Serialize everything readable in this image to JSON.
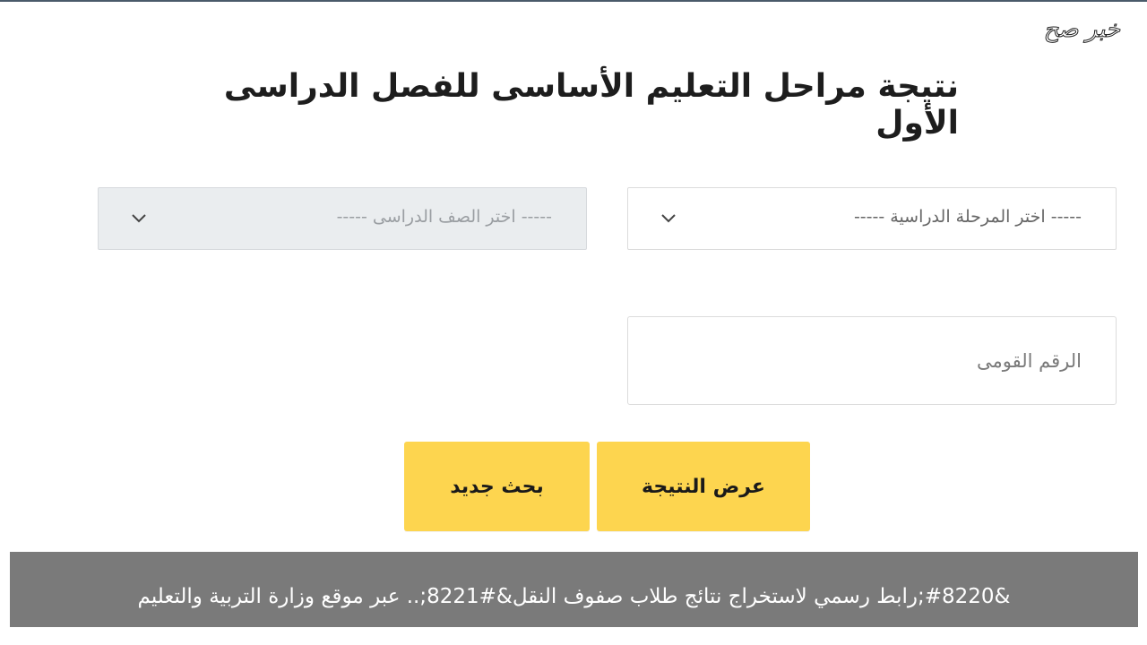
{
  "watermark": "خبر صح",
  "title": "نتيجة مراحل التعليم الأساسى للفصل الدراسى الأول",
  "form": {
    "stage_select": {
      "selected": "----- اختر المرحلة الدراسية -----"
    },
    "grade_select": {
      "selected": "----- اختر الصف الدراسى -----"
    },
    "national_id": {
      "placeholder": "الرقم القومى",
      "value": ""
    }
  },
  "buttons": {
    "show_result": "عرض النتيجة",
    "new_search": "بحث جديد"
  },
  "caption": "&#8220;رابط رسمي لاستخراج نتائج طلاب صفوف النقل&#8221;.. عبر موقع وزارة التربية والتعليم",
  "colors": {
    "button_yellow": "#fdd54f",
    "caption_bg": "#7a7a7a",
    "disabled_select_bg": "#eaedef"
  },
  "icons": {
    "select_arrow": "chevron-down-icon"
  }
}
